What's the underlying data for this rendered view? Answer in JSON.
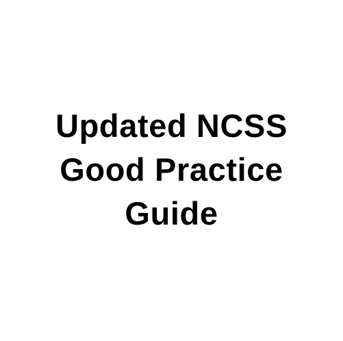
{
  "title": {
    "lines": [
      "Updated NCSS",
      "Good Practice",
      "Guide"
    ]
  },
  "colors": {
    "background": "#ffffff",
    "text": "#000000"
  }
}
